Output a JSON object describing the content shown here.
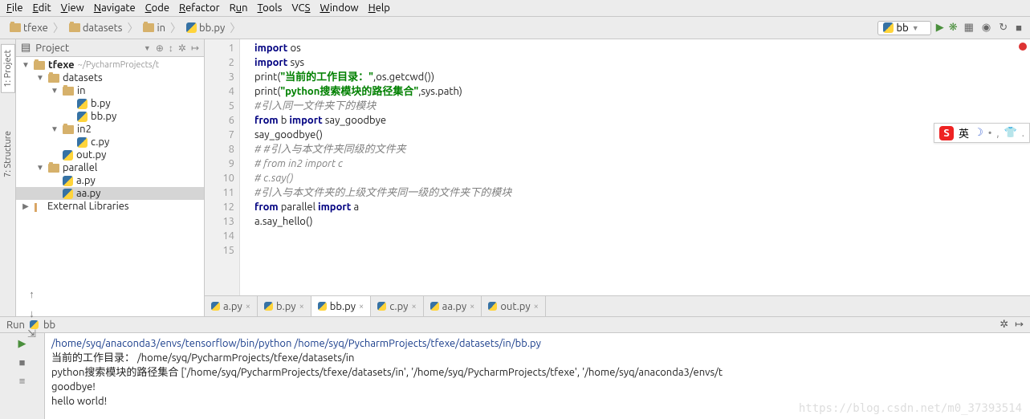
{
  "menu": [
    "File",
    "Edit",
    "View",
    "Navigate",
    "Code",
    "Refactor",
    "Run",
    "Tools",
    "VCS",
    "Window",
    "Help"
  ],
  "breadcrumb": [
    {
      "icon": "folder",
      "label": "tfexe"
    },
    {
      "icon": "folder",
      "label": "datasets"
    },
    {
      "icon": "folder",
      "label": "in"
    },
    {
      "icon": "py",
      "label": "bb.py"
    }
  ],
  "run_config_label": "bb",
  "sidebar": {
    "title": "Project",
    "project_name": "tfexe",
    "project_path": "~/PycharmProjects/t",
    "tree": [
      {
        "depth": 0,
        "tw": "▼",
        "icon": "folder",
        "label": "tfexe",
        "note": "~/PycharmProjects/t",
        "bold": true
      },
      {
        "depth": 1,
        "tw": "▼",
        "icon": "folder",
        "label": "datasets"
      },
      {
        "depth": 2,
        "tw": "▼",
        "icon": "folder",
        "label": "in"
      },
      {
        "depth": 3,
        "tw": "",
        "icon": "py",
        "label": "b.py"
      },
      {
        "depth": 3,
        "tw": "",
        "icon": "py",
        "label": "bb.py"
      },
      {
        "depth": 2,
        "tw": "▼",
        "icon": "folder",
        "label": "in2"
      },
      {
        "depth": 3,
        "tw": "",
        "icon": "py",
        "label": "c.py"
      },
      {
        "depth": 2,
        "tw": "",
        "icon": "py",
        "label": "out.py"
      },
      {
        "depth": 1,
        "tw": "▼",
        "icon": "folder",
        "label": "parallel"
      },
      {
        "depth": 2,
        "tw": "",
        "icon": "py",
        "label": "a.py"
      },
      {
        "depth": 2,
        "tw": "",
        "icon": "py",
        "label": "aa.py",
        "selected": true
      },
      {
        "depth": 0,
        "tw": "▶",
        "icon": "lib",
        "label": "External Libraries"
      }
    ]
  },
  "side_tabs": {
    "project": "1: Project",
    "structure": "7: Structure"
  },
  "code": {
    "lines": [
      [
        {
          "t": "import ",
          "c": "kw"
        },
        {
          "t": "os"
        }
      ],
      [
        {
          "t": "import ",
          "c": "kw"
        },
        {
          "t": "sys"
        }
      ],
      [
        {
          "t": "print("
        },
        {
          "t": "\"当前的工作目录：\"",
          "c": "str"
        },
        {
          "t": ",os.getcwd())"
        }
      ],
      [
        {
          "t": "print("
        },
        {
          "t": "\"python搜索模块的路径集合\"",
          "c": "str"
        },
        {
          "t": ",sys.path)"
        }
      ],
      [
        {
          "t": "#引入同一文件夹下的模块",
          "c": "cmt"
        }
      ],
      [
        {
          "t": "from ",
          "c": "kw"
        },
        {
          "t": "b "
        },
        {
          "t": "import ",
          "c": "kw"
        },
        {
          "t": "say_goodbye"
        }
      ],
      [
        {
          "t": "say_goodbye()"
        }
      ],
      [
        {
          "t": ""
        }
      ],
      [
        {
          "t": "# #引入与本文件夹同级的文件夹",
          "c": "cmt"
        }
      ],
      [
        {
          "t": "# from in2 import c",
          "c": "cmt"
        }
      ],
      [
        {
          "t": "# c.say()",
          "c": "cmt"
        }
      ],
      [
        {
          "t": ""
        }
      ],
      [
        {
          "t": "#引入与本文件夹的上级文件夹同一级的文件夹下的模块",
          "c": "cmt"
        }
      ],
      [
        {
          "t": "from ",
          "c": "kw"
        },
        {
          "t": "parallel "
        },
        {
          "t": "import ",
          "c": "kw"
        },
        {
          "t": "a"
        }
      ],
      [
        {
          "t": "a.say_hello()"
        }
      ]
    ]
  },
  "editor_tabs": [
    {
      "label": "a.py",
      "active": false
    },
    {
      "label": "b.py",
      "active": false
    },
    {
      "label": "bb.py",
      "active": true
    },
    {
      "label": "c.py",
      "active": false
    },
    {
      "label": "aa.py",
      "active": false
    },
    {
      "label": "out.py",
      "active": false
    }
  ],
  "run": {
    "title": "Run",
    "script": "bb",
    "cmd": "/home/syq/anaconda3/envs/tensorflow/bin/python /home/syq/PycharmProjects/tfexe/datasets/in/bb.py",
    "out1": "当前的工作目录：  /home/syq/PycharmProjects/tfexe/datasets/in",
    "out2": "python搜索模块的路径集合 ['/home/syq/PycharmProjects/tfexe/datasets/in', '/home/syq/PycharmProjects/tfexe', '/home/syq/anaconda3/envs/t",
    "out3": "goodbye!",
    "out4": "hello world!"
  },
  "watermark": "https://blog.csdn.net/m0_37393514",
  "ime": {
    "label": "英"
  }
}
